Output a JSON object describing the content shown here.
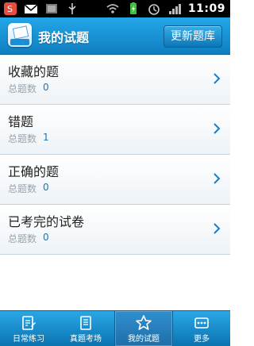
{
  "status_bar": {
    "time": "11:09",
    "left_icons": [
      "s-app-icon",
      "mail-icon",
      "image-icon",
      "usb-icon"
    ],
    "right_icons": [
      "wifi-icon",
      "battery-charging-icon",
      "alarm-icon",
      "signal-icon"
    ]
  },
  "header": {
    "app_logo_text": "公务员",
    "title": "我的试题",
    "update_button": "更新题库"
  },
  "list": [
    {
      "title": "收藏的题",
      "sub_label": "总题数",
      "count": "0"
    },
    {
      "title": "错题",
      "sub_label": "总题数",
      "count": "1"
    },
    {
      "title": "正确的题",
      "sub_label": "总题数",
      "count": "0"
    },
    {
      "title": "已考完的试卷",
      "sub_label": "总题数",
      "count": "0"
    }
  ],
  "tabs": [
    {
      "label": "日常练习",
      "icon": "edit-icon"
    },
    {
      "label": "真题考场",
      "icon": "book-icon"
    },
    {
      "label": "我的试题",
      "icon": "star-icon",
      "active": true
    },
    {
      "label": "更多",
      "icon": "more-icon"
    }
  ],
  "colors": {
    "header_blue": "#1b8fd3",
    "count_blue": "#1876b8"
  }
}
